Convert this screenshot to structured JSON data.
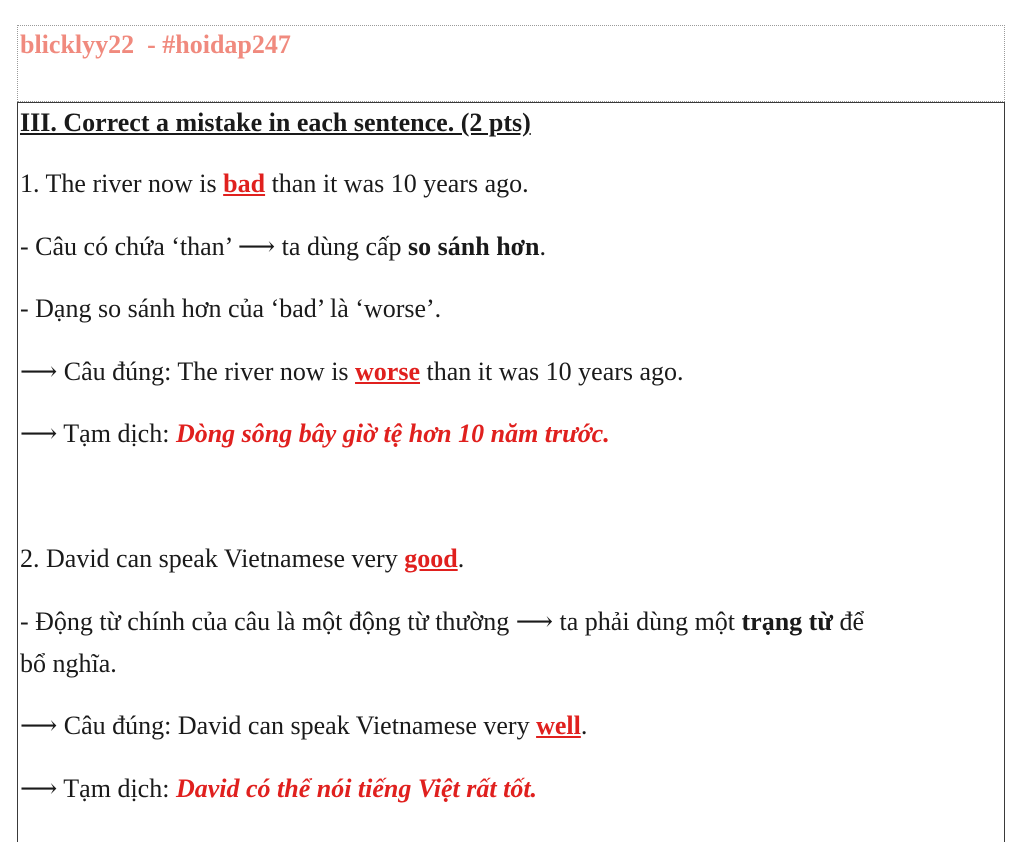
{
  "header": {
    "author": "blicklyy22  - #hoidap247"
  },
  "section": {
    "title": "III. Correct a mistake in each sentence. (2 pts)"
  },
  "q1": {
    "prefix": "1. The river now is ",
    "error": "bad",
    "suffix": " than it was 10 years ago.",
    "note1_pre": "- Câu có chứa ‘than’ ⟶ ta dùng cấp ",
    "note1_bold": "so sánh hơn",
    "note1_post": ".",
    "note2": "- Dạng so sánh hơn của ‘bad’ là ‘worse’.",
    "answer_pre": "⟶ Câu đúng: The river now is ",
    "answer_word": "worse",
    "answer_post": " than it was 10 years ago.",
    "trans_label": "⟶ Tạm dịch: ",
    "trans_text": "Dòng sông bây giờ tệ hơn 10 năm trước."
  },
  "q2": {
    "prefix": "2. David can speak Vietnamese very ",
    "error": "good",
    "suffix": ".",
    "note1_pre": "- Động từ chính của câu là một động từ thường ⟶ ta phải dùng một ",
    "note1_bold": "trạng từ",
    "note1_post": " để",
    "note1_line2": "bổ nghĩa.",
    "answer_pre": "⟶ Câu đúng: David can speak Vietnamese very ",
    "answer_word": "well",
    "answer_post": ".",
    "trans_label": "⟶ Tạm dịch: ",
    "trans_text": "David có thể nói tiếng Việt rất tốt."
  }
}
